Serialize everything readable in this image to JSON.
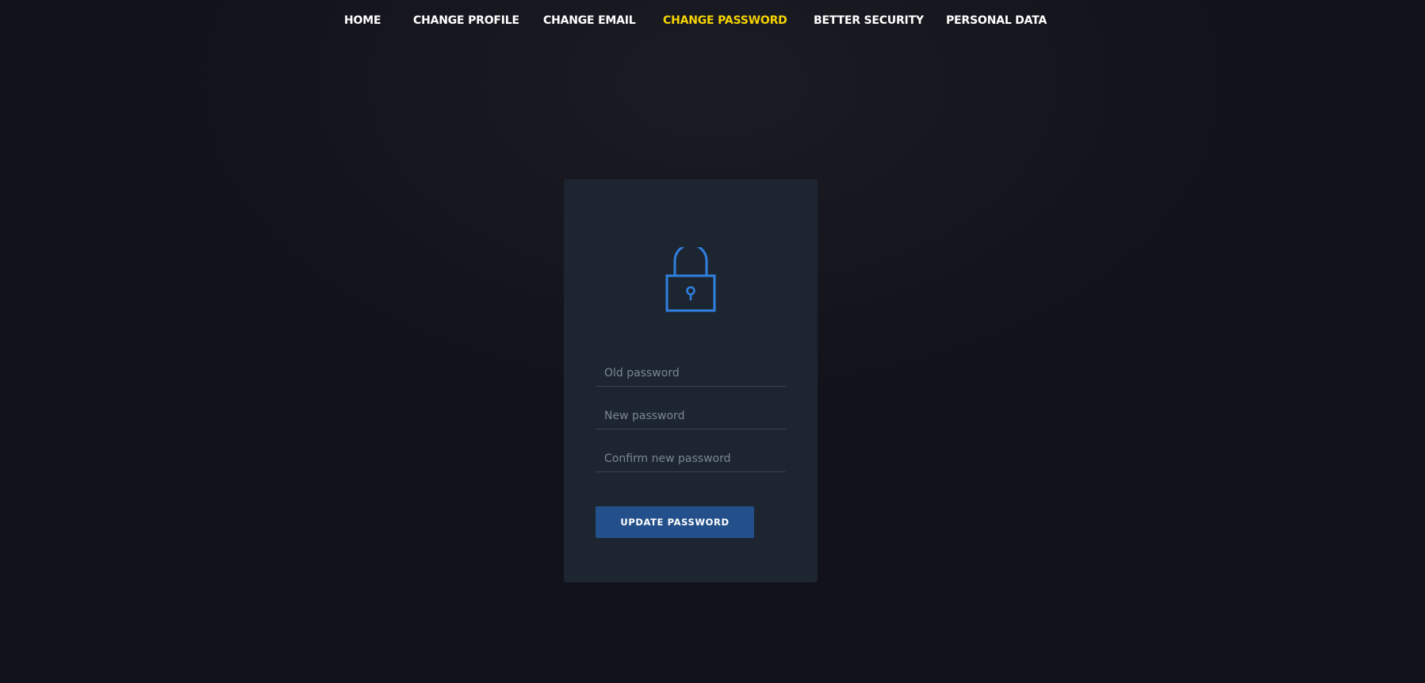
{
  "nav": {
    "items": [
      {
        "label": "HOME",
        "active": false
      },
      {
        "label": "CHANGE PROFILE",
        "active": false
      },
      {
        "label": "CHANGE EMAIL",
        "active": false
      },
      {
        "label": "CHANGE PASSWORD",
        "active": true
      },
      {
        "label": "BETTER SECURITY",
        "active": false
      },
      {
        "label": "PERSONAL DATA",
        "active": false
      }
    ]
  },
  "form": {
    "icon": "lock-icon",
    "old_password_placeholder": "Old password",
    "new_password_placeholder": "New password",
    "confirm_password_placeholder": "Confirm new password",
    "submit_label": "UPDATE PASSWORD"
  },
  "colors": {
    "background": "#12121a",
    "card": "#1c2530",
    "accent": "#2f80e0",
    "active_nav": "#f5d300",
    "button": "#23508a"
  }
}
